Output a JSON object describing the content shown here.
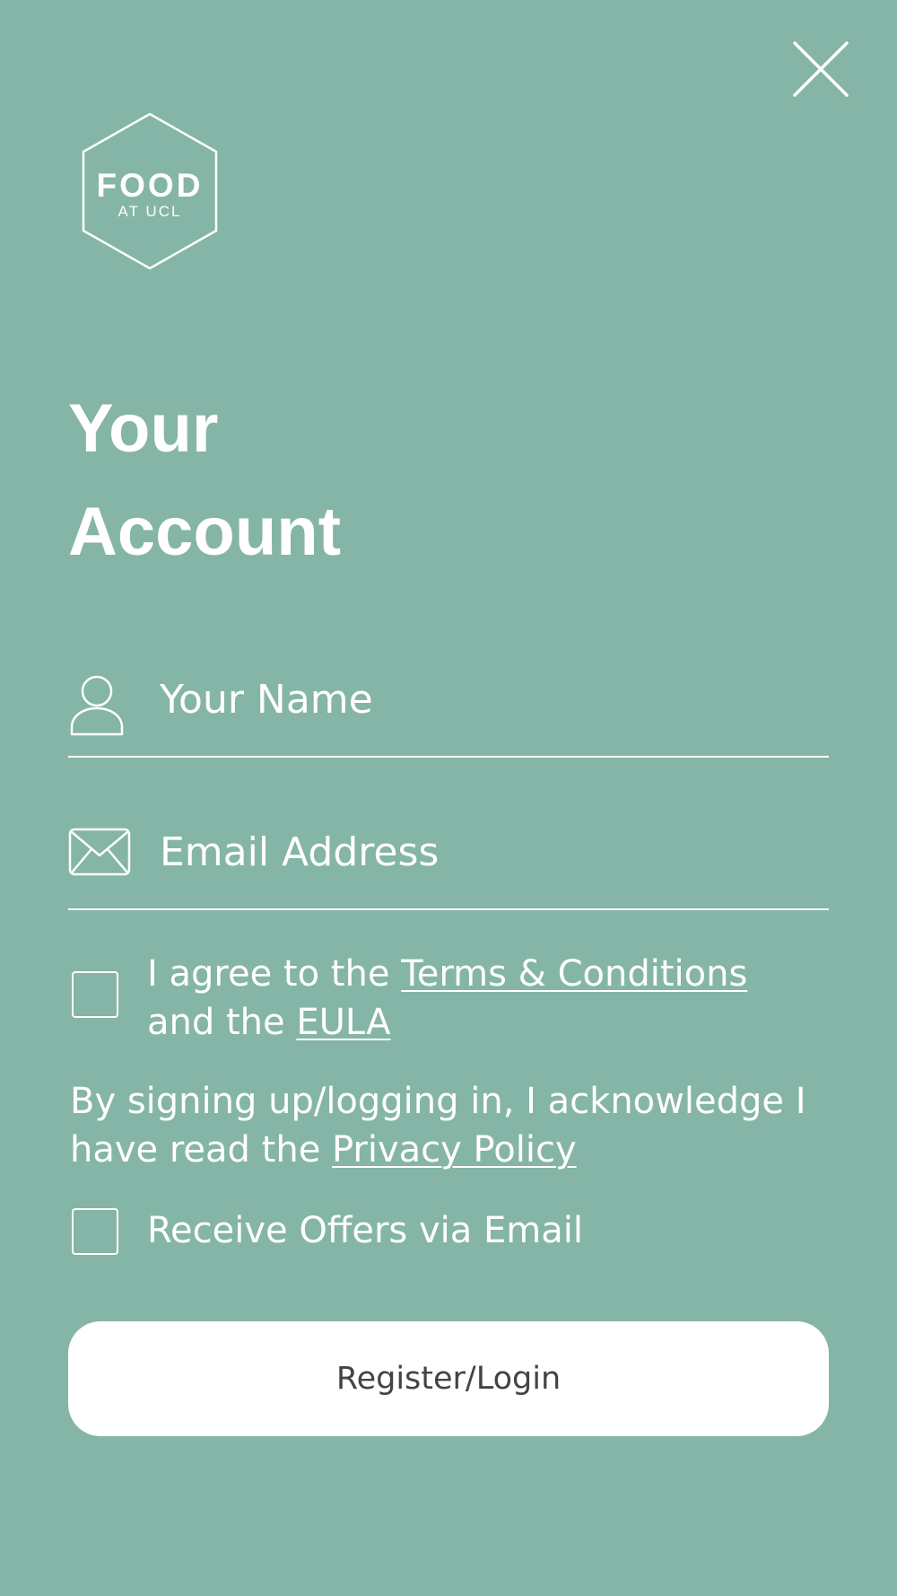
{
  "colors": {
    "background": "#85b5a6",
    "foreground": "#ffffff",
    "button_text": "#444444"
  },
  "header": {
    "close_icon": "close-icon"
  },
  "logo": {
    "word": "FOOD",
    "sub": "AT UCL"
  },
  "title": {
    "line1": "Your",
    "line2": "Account"
  },
  "form": {
    "name_placeholder": "Your Name",
    "name_value": "",
    "name_icon": "user-icon",
    "email_placeholder": "Email Address",
    "email_value": "",
    "email_icon": "envelope-icon"
  },
  "terms": {
    "checked": false,
    "prefix": "I agree to the ",
    "terms_link": "Terms & Conditions",
    "middle": "and the ",
    "eula_link": "EULA"
  },
  "privacy": {
    "text_line1": "By signing up/logging in, I acknowledge I",
    "text_line2_prefix": "have read the ",
    "policy_link": "Privacy Policy"
  },
  "offers": {
    "checked": false,
    "label": "Receive Offers via Email"
  },
  "submit": {
    "label": "Register/Login"
  }
}
